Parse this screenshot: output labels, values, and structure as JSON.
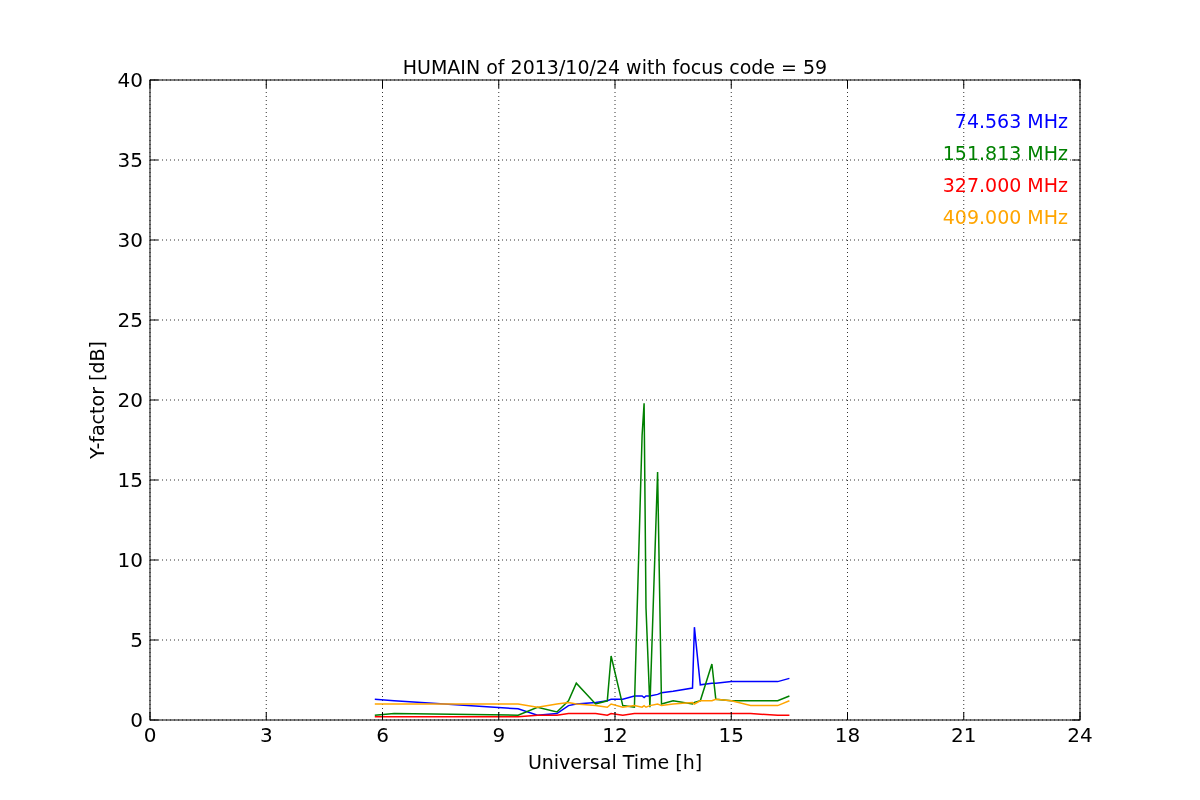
{
  "chart_data": {
    "type": "line",
    "title": "HUMAIN of 2013/10/24 with focus code = 59",
    "xlabel": "Universal Time [h]",
    "ylabel": "Y-factor [dB]",
    "xlim": [
      0,
      24
    ],
    "ylim": [
      0,
      40
    ],
    "xticks": [
      0,
      3,
      6,
      9,
      12,
      15,
      18,
      21,
      24
    ],
    "yticks": [
      0,
      5,
      10,
      15,
      20,
      25,
      30,
      35,
      40
    ],
    "grid": true,
    "x": [
      5.8,
      6.3,
      9.5,
      10.0,
      10.5,
      10.8,
      11.0,
      11.5,
      11.8,
      11.9,
      12.2,
      12.5,
      12.7,
      12.75,
      12.8,
      12.9,
      13.1,
      13.2,
      13.5,
      14.0,
      14.05,
      14.2,
      14.5,
      14.6,
      15.0,
      15.5,
      16.2,
      16.5
    ],
    "series": [
      {
        "name": "74.563 MHz",
        "color": "#0000ff",
        "values": [
          1.3,
          1.2,
          0.7,
          0.3,
          0.4,
          0.9,
          1.0,
          1.1,
          1.2,
          1.3,
          1.3,
          1.5,
          1.5,
          1.4,
          1.5,
          1.5,
          1.6,
          1.7,
          1.8,
          2.0,
          5.8,
          2.2,
          2.3,
          2.3,
          2.4,
          2.4,
          2.4,
          2.6
        ]
      },
      {
        "name": "151.813 MHz",
        "color": "#008000",
        "values": [
          0.3,
          0.4,
          0.3,
          0.8,
          0.5,
          1.2,
          2.3,
          1.0,
          1.2,
          4.0,
          0.9,
          0.8,
          17.8,
          19.8,
          7.0,
          0.8,
          15.5,
          1.0,
          1.2,
          1.0,
          1.1,
          1.2,
          3.5,
          1.3,
          1.2,
          1.2,
          1.2,
          1.5
        ]
      },
      {
        "name": "327.000 MHz",
        "color": "#ff0000",
        "values": [
          0.2,
          0.2,
          0.2,
          0.3,
          0.3,
          0.4,
          0.4,
          0.4,
          0.3,
          0.4,
          0.3,
          0.4,
          0.4,
          0.4,
          0.4,
          0.4,
          0.4,
          0.4,
          0.4,
          0.4,
          0.4,
          0.4,
          0.4,
          0.4,
          0.4,
          0.4,
          0.3,
          0.3
        ]
      },
      {
        "name": "409.000 MHz",
        "color": "#ffa500",
        "values": [
          1.0,
          1.0,
          1.0,
          0.8,
          1.0,
          1.1,
          1.0,
          0.9,
          0.8,
          1.0,
          0.8,
          0.9,
          0.8,
          0.9,
          0.8,
          0.9,
          1.0,
          0.9,
          1.0,
          1.1,
          1.0,
          1.2,
          1.2,
          1.3,
          1.2,
          0.9,
          0.9,
          1.2
        ]
      }
    ]
  }
}
